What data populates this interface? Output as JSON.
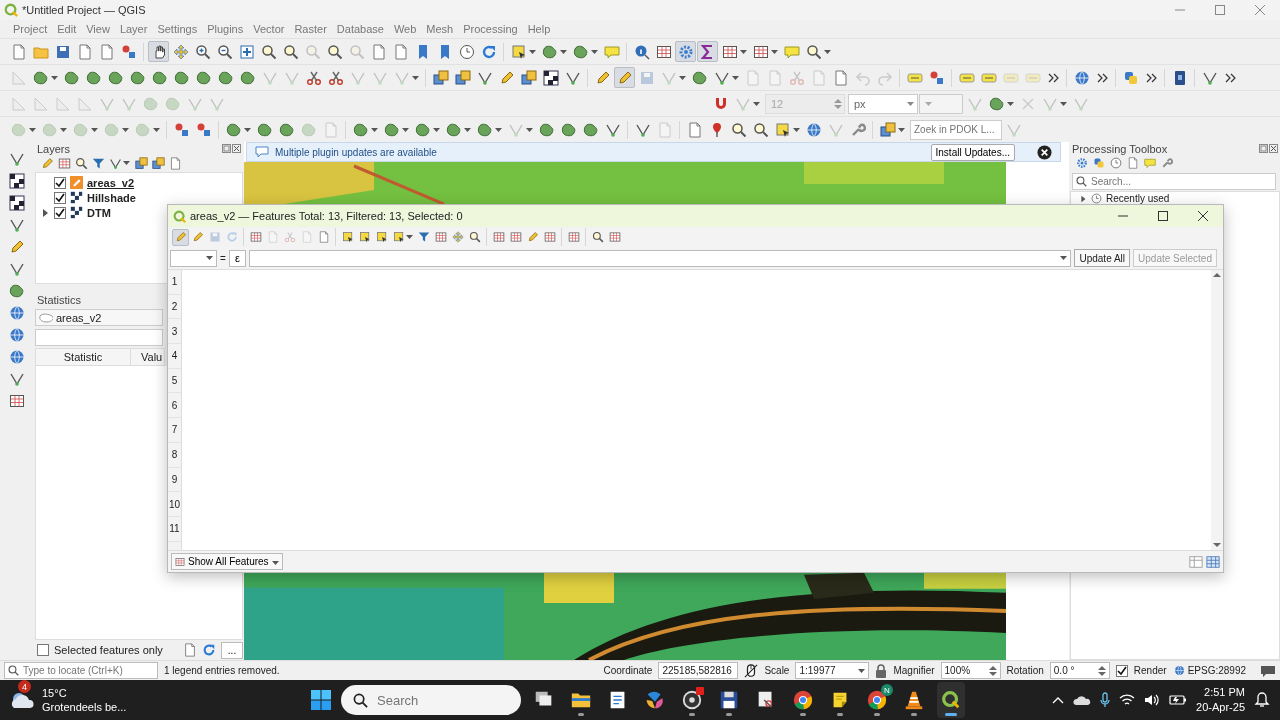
{
  "window": {
    "title": "*Untitled Project — QGIS"
  },
  "menu": [
    "Project",
    "Edit",
    "View",
    "Layer",
    "Settings",
    "Plugins",
    "Vector",
    "Raster",
    "Database",
    "Web",
    "Mesh",
    "Processing",
    "Help"
  ],
  "toolbars": [
    {
      "tools": [
        {
          "on": false,
          "disabled": false
        },
        {
          "on": false,
          "disabled": false
        },
        {
          "on": false,
          "disabled": false
        },
        {
          "on": false,
          "disabled": false
        },
        {
          "on": false,
          "disabled": false
        },
        {
          "on": false,
          "disabled": false
        },
        {
          "on": true,
          "disabled": false
        },
        {
          "on": false,
          "disabled": false
        },
        {
          "on": false,
          "disabled": false
        },
        {
          "on": false,
          "disabled": false
        },
        {
          "on": false,
          "disabled": false
        },
        {
          "on": false,
          "disabled": false
        },
        {
          "on": false,
          "disabled": false
        },
        {
          "on": false,
          "disabled": true
        },
        {
          "on": false,
          "disabled": false
        },
        {
          "on": false,
          "disabled": true
        },
        {
          "on": false,
          "disabled": false
        },
        {
          "on": false,
          "disabled": false
        },
        {
          "on": false,
          "disabled": false
        },
        {
          "on": false,
          "disabled": false
        },
        {
          "on": false,
          "disabled": false
        },
        {
          "on": false,
          "disabled": false
        },
        {
          "on": false,
          "disabled": false
        },
        {
          "on": false,
          "disabled": false
        },
        {
          "on": false,
          "disabled": false
        },
        {
          "on": false,
          "disabled": false
        },
        {
          "on": false,
          "disabled": false
        },
        {
          "on": false,
          "disabled": false
        },
        {
          "on": true,
          "disabled": false
        },
        {
          "on": true,
          "disabled": false
        },
        {
          "on": false,
          "disabled": false
        },
        {
          "on": false,
          "disabled": false
        },
        {
          "on": false,
          "disabled": false
        },
        {
          "on": false,
          "disabled": false
        }
      ]
    },
    {
      "tools": [
        {
          "on": false,
          "disabled": true
        },
        {
          "on": false,
          "disabled": false
        },
        {
          "on": false,
          "disabled": false
        },
        {
          "on": false,
          "disabled": false
        },
        {
          "on": false,
          "disabled": false
        },
        {
          "on": false,
          "disabled": false
        },
        {
          "on": false,
          "disabled": false
        },
        {
          "on": false,
          "disabled": false
        },
        {
          "on": false,
          "disabled": false
        },
        {
          "on": false,
          "disabled": false
        },
        {
          "on": false,
          "disabled": false
        },
        {
          "on": false,
          "disabled": true
        },
        {
          "on": false,
          "disabled": true
        },
        {
          "on": false,
          "disabled": false
        },
        {
          "on": false,
          "disabled": false
        },
        {
          "on": false,
          "disabled": true
        },
        {
          "on": false,
          "disabled": true
        },
        {
          "on": false,
          "disabled": true
        },
        {
          "on": false,
          "disabled": false
        },
        {
          "on": false,
          "disabled": false
        },
        {
          "on": false,
          "disabled": false
        },
        {
          "on": false,
          "disabled": false
        },
        {
          "on": false,
          "disabled": false
        },
        {
          "on": false,
          "disabled": false
        },
        {
          "on": false,
          "disabled": false
        },
        {
          "on": false,
          "disabled": false
        },
        {
          "on": true,
          "disabled": false
        },
        {
          "on": false,
          "disabled": true
        },
        {
          "on": false,
          "disabled": true
        },
        {
          "on": false,
          "disabled": false
        },
        {
          "on": false,
          "disabled": false
        },
        {
          "on": false,
          "disabled": true
        },
        {
          "on": false,
          "disabled": true
        },
        {
          "on": false,
          "disabled": true
        },
        {
          "on": false,
          "disabled": true
        },
        {
          "on": false,
          "disabled": false
        },
        {
          "on": false,
          "disabled": true
        },
        {
          "on": false,
          "disabled": true
        },
        {
          "on": false,
          "disabled": false
        },
        {
          "on": false,
          "disabled": false
        },
        {
          "on": false,
          "disabled": false
        },
        {
          "on": false,
          "disabled": false
        },
        {
          "on": false,
          "disabled": true
        },
        {
          "on": false,
          "disabled": true
        },
        {
          "on": false,
          "disabled": false
        },
        {
          "on": false,
          "disabled": false
        },
        {
          "on": false,
          "disabled": false
        },
        {
          "on": false,
          "disabled": false
        }
      ]
    },
    {
      "tools": [
        {
          "on": false,
          "disabled": true
        },
        {
          "on": false,
          "disabled": true
        },
        {
          "on": false,
          "disabled": true
        },
        {
          "on": false,
          "disabled": true
        },
        {
          "on": false,
          "disabled": true
        },
        {
          "on": false,
          "disabled": true
        },
        {
          "on": false,
          "disabled": true
        },
        {
          "on": false,
          "disabled": true
        },
        {
          "on": false,
          "disabled": true
        },
        {
          "on": false,
          "disabled": true
        },
        {
          "on": false,
          "disabled": false
        },
        {
          "on": false,
          "disabled": true
        },
        {
          "on": false,
          "disabled": true
        },
        {
          "on": false,
          "disabled": false
        },
        {
          "on": false,
          "disabled": true
        },
        {
          "on": false,
          "disabled": true
        },
        {
          "on": false,
          "disabled": true
        }
      ]
    },
    {
      "tools": [
        {
          "on": false,
          "disabled": true
        },
        {
          "on": false,
          "disabled": true
        },
        {
          "on": false,
          "disabled": true
        },
        {
          "on": false,
          "disabled": true
        },
        {
          "on": false,
          "disabled": true
        },
        {
          "on": false,
          "disabled": false
        },
        {
          "on": false,
          "disabled": false
        },
        {
          "on": false,
          "disabled": false
        },
        {
          "on": false,
          "disabled": false
        },
        {
          "on": false,
          "disabled": false
        },
        {
          "on": false,
          "disabled": true
        },
        {
          "on": false,
          "disabled": true
        },
        {
          "on": false,
          "disabled": false
        },
        {
          "on": false,
          "disabled": false
        },
        {
          "on": false,
          "disabled": false
        },
        {
          "on": false,
          "disabled": false
        },
        {
          "on": false,
          "disabled": false
        },
        {
          "on": false,
          "disabled": true
        },
        {
          "on": false,
          "disabled": false
        },
        {
          "on": false,
          "disabled": false
        },
        {
          "on": false,
          "disabled": false
        },
        {
          "on": false,
          "disabled": false
        },
        {
          "on": false,
          "disabled": false
        },
        {
          "on": false,
          "disabled": true
        },
        {
          "on": false,
          "disabled": false
        },
        {
          "on": false,
          "disabled": false
        },
        {
          "on": false,
          "disabled": false
        },
        {
          "on": false,
          "disabled": false
        },
        {
          "on": false,
          "disabled": false
        },
        {
          "on": false,
          "disabled": false
        },
        {
          "on": false,
          "disabled": true
        },
        {
          "on": false,
          "disabled": false
        },
        {
          "on": false,
          "disabled": false
        },
        {
          "on": false,
          "disabled": true
        }
      ]
    }
  ],
  "snapping": {
    "tolerance": "12",
    "tolerance_disabled": true,
    "unit": "px"
  },
  "pdok_search": {
    "placeholder": "Zoek in PDOK L..."
  },
  "layers_panel": {
    "title": "Layers",
    "layers": [
      {
        "name": "areas_v2",
        "kind": "vector",
        "checked": true,
        "editing": true,
        "collapsible": false
      },
      {
        "name": "Hillshade",
        "kind": "raster",
        "checked": true,
        "editing": false,
        "collapsible": false
      },
      {
        "name": "DTM",
        "kind": "raster",
        "checked": true,
        "editing": false,
        "collapsible": true
      }
    ]
  },
  "statistics_panel": {
    "title": "Statistics",
    "layer": "areas_v2",
    "columns": [
      "Statistic",
      "Valu"
    ],
    "selected_only": {
      "label": "Selected features only",
      "checked": false
    },
    "more_button": "..."
  },
  "message_bar": {
    "text": "Multiple plugin updates are available",
    "button": "Install Updates..."
  },
  "processing_toolbox": {
    "title": "Processing Toolbox",
    "search_placeholder": "Search...",
    "items": [
      {
        "label": "Recently used"
      }
    ]
  },
  "attribute_table": {
    "title": "areas_v2 — Features Total: 13, Filtered: 13, Selected: 0",
    "tools": [
      {
        "on": true,
        "disabled": false
      },
      {
        "on": false,
        "disabled": false
      },
      {
        "on": false,
        "disabled": true
      },
      {
        "on": false,
        "disabled": true
      },
      {
        "on": false,
        "disabled": false
      },
      {
        "on": false,
        "disabled": true
      },
      {
        "on": false,
        "disabled": true
      },
      {
        "on": false,
        "disabled": true
      },
      {
        "on": false,
        "disabled": false
      },
      {
        "on": false,
        "disabled": false
      },
      {
        "on": false,
        "disabled": false
      },
      {
        "on": false,
        "disabled": false
      },
      {
        "on": false,
        "disabled": false
      },
      {
        "on": false,
        "disabled": false
      },
      {
        "on": false,
        "disabled": false
      },
      {
        "on": false,
        "disabled": false
      },
      {
        "on": false,
        "disabled": false
      },
      {
        "on": false,
        "disabled": false
      },
      {
        "on": false,
        "disabled": false
      },
      {
        "on": false,
        "disabled": false
      },
      {
        "on": false,
        "disabled": false
      },
      {
        "on": false,
        "disabled": false
      },
      {
        "on": false,
        "disabled": false
      },
      {
        "on": false,
        "disabled": false
      }
    ],
    "equals": "=",
    "expression_button": "ε",
    "update_all": {
      "label": "Update All",
      "disabled": false
    },
    "update_selected": {
      "label": "Update Selected",
      "disabled": true
    },
    "row_numbers": [
      "1",
      "2",
      "3",
      "4",
      "5",
      "6",
      "7",
      "8",
      "9",
      "10",
      "11"
    ],
    "filter_button": "Show All Features"
  },
  "status_bar": {
    "locate_placeholder": "Type to locate (Ctrl+K)",
    "message": "1 legend entries removed.",
    "coordinate_label": "Coordinate",
    "coordinate": "225185,582816",
    "scale_label": "Scale",
    "scale": "1:19977",
    "magnifier_label": "Magnifier",
    "magnifier": "100%",
    "rotation_label": "Rotation",
    "rotation": "0.0 °",
    "render": {
      "label": "Render",
      "checked": true
    },
    "crs": "EPSG:28992"
  },
  "taskbar": {
    "weather": {
      "badge": "4",
      "temperature": "15°C",
      "condition": "Grotendeels be..."
    },
    "search_placeholder": "Search",
    "apps": [
      {
        "running": false,
        "active": false,
        "alert": false
      },
      {
        "running": true,
        "active": false,
        "alert": false
      },
      {
        "running": false,
        "active": false,
        "alert": false
      },
      {
        "running": false,
        "active": false,
        "alert": false
      },
      {
        "running": true,
        "active": false,
        "alert": true
      },
      {
        "running": true,
        "active": false,
        "alert": false
      },
      {
        "running": false,
        "active": false,
        "alert": false
      },
      {
        "running": true,
        "active": false,
        "alert": false
      },
      {
        "running": true,
        "active": false,
        "alert": false
      },
      {
        "running": true,
        "active": false,
        "alert": false,
        "badge": "N"
      },
      {
        "running": true,
        "active": false,
        "alert": false
      },
      {
        "running": true,
        "active": true,
        "alert": false
      }
    ],
    "clock": {
      "time": "2:51 PM",
      "date": "20-Apr-25"
    }
  }
}
